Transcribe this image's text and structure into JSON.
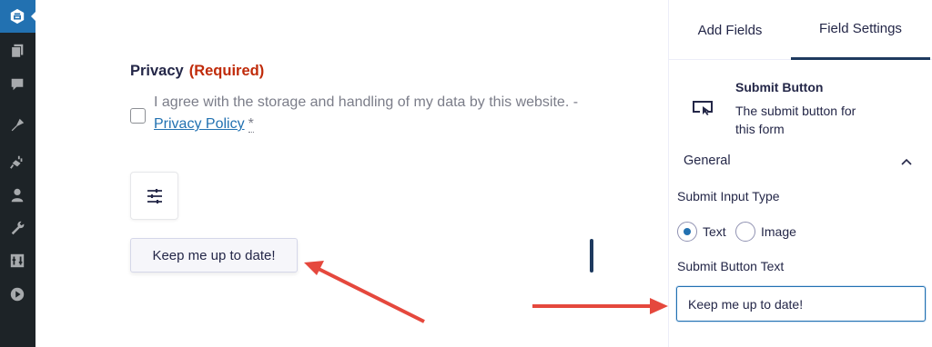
{
  "admin_menu": {
    "icons": [
      "gravity-forms-icon",
      "pages-icon",
      "comments-icon",
      "appearance-icon",
      "plugins-icon",
      "users-icon",
      "tools-icon",
      "settings-icon",
      "media-play-icon"
    ]
  },
  "canvas": {
    "privacy": {
      "title": "Privacy",
      "required": "(Required)",
      "consent_text": "I agree with the storage and handling of my data by this website. - ",
      "policy_link": "Privacy Policy",
      "asterisk": "*"
    },
    "preview_button_label": "Keep me up to date!"
  },
  "panel": {
    "tabs": [
      {
        "label": "Add Fields"
      },
      {
        "label": "Field Settings"
      }
    ],
    "field": {
      "name": "Submit Button",
      "description": "The submit button for this form"
    },
    "section_title": "General",
    "input_type_label": "Submit Input Type",
    "radio_options": [
      {
        "label": "Text",
        "checked": true
      },
      {
        "label": "Image",
        "checked": false
      }
    ],
    "button_text_label": "Submit Button Text",
    "button_text_value": "Keep me up to date!"
  },
  "colors": {
    "required": "#c02b0a",
    "accent": "#2271b1",
    "arrow": "#e5483d",
    "admin_bg": "#1d2327"
  }
}
